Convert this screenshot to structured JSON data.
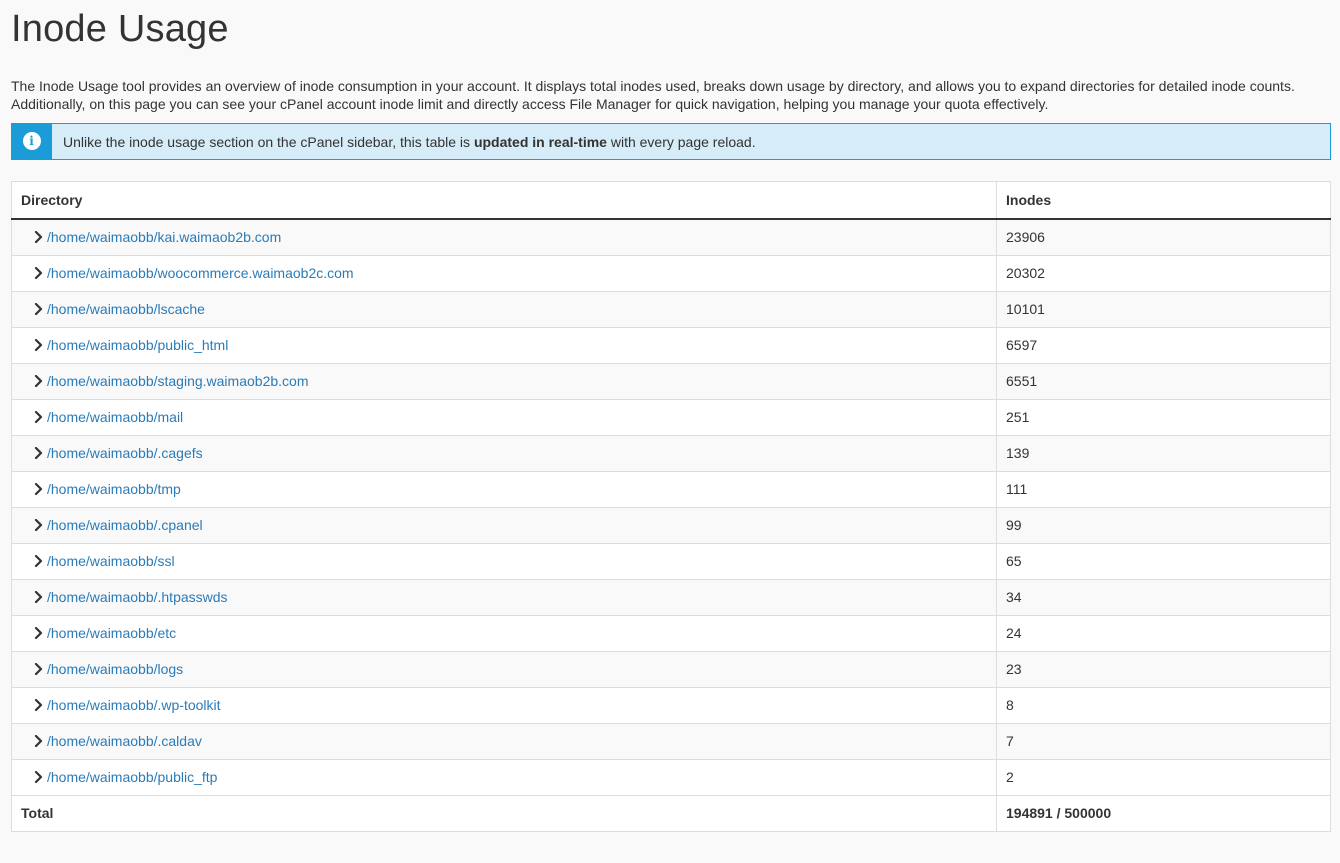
{
  "page": {
    "title": "Inode Usage",
    "description": "The Inode Usage tool provides an overview of inode consumption in your account. It displays total inodes used, breaks down usage by directory, and allows you to expand directories for detailed inode counts. Additionally, on this page you can see your cPanel account inode limit and directly access File Manager for quick navigation, helping you manage your quota effectively."
  },
  "alert": {
    "icon": "info-icon",
    "text_before": "Unlike the inode usage section on the cPanel sidebar, this table is ",
    "text_bold": "updated in real-time",
    "text_after": " with every page reload."
  },
  "table": {
    "headers": {
      "directory": "Directory",
      "inodes": "Inodes"
    },
    "rows": [
      {
        "path": "/home/waimaobb/kai.waimaob2b.com",
        "inodes": "23906"
      },
      {
        "path": "/home/waimaobb/woocommerce.waimaob2c.com",
        "inodes": "20302"
      },
      {
        "path": "/home/waimaobb/lscache",
        "inodes": "10101"
      },
      {
        "path": "/home/waimaobb/public_html",
        "inodes": "6597"
      },
      {
        "path": "/home/waimaobb/staging.waimaob2b.com",
        "inodes": "6551"
      },
      {
        "path": "/home/waimaobb/mail",
        "inodes": "251"
      },
      {
        "path": "/home/waimaobb/.cagefs",
        "inodes": "139"
      },
      {
        "path": "/home/waimaobb/tmp",
        "inodes": "111"
      },
      {
        "path": "/home/waimaobb/.cpanel",
        "inodes": "99"
      },
      {
        "path": "/home/waimaobb/ssl",
        "inodes": "65"
      },
      {
        "path": "/home/waimaobb/.htpasswds",
        "inodes": "34"
      },
      {
        "path": "/home/waimaobb/etc",
        "inodes": "24"
      },
      {
        "path": "/home/waimaobb/logs",
        "inodes": "23"
      },
      {
        "path": "/home/waimaobb/.wp-toolkit",
        "inodes": "8"
      },
      {
        "path": "/home/waimaobb/.caldav",
        "inodes": "7"
      },
      {
        "path": "/home/waimaobb/public_ftp",
        "inodes": "2"
      }
    ],
    "total": {
      "label": "Total",
      "value": "194891 / 500000"
    }
  },
  "colors": {
    "link": "#2a7bb8",
    "alert_border": "#1b9bd7",
    "alert_bg": "#d6ecf8"
  },
  "icons": {
    "row_expand": "chevron-right-icon",
    "alert": "info-icon"
  }
}
